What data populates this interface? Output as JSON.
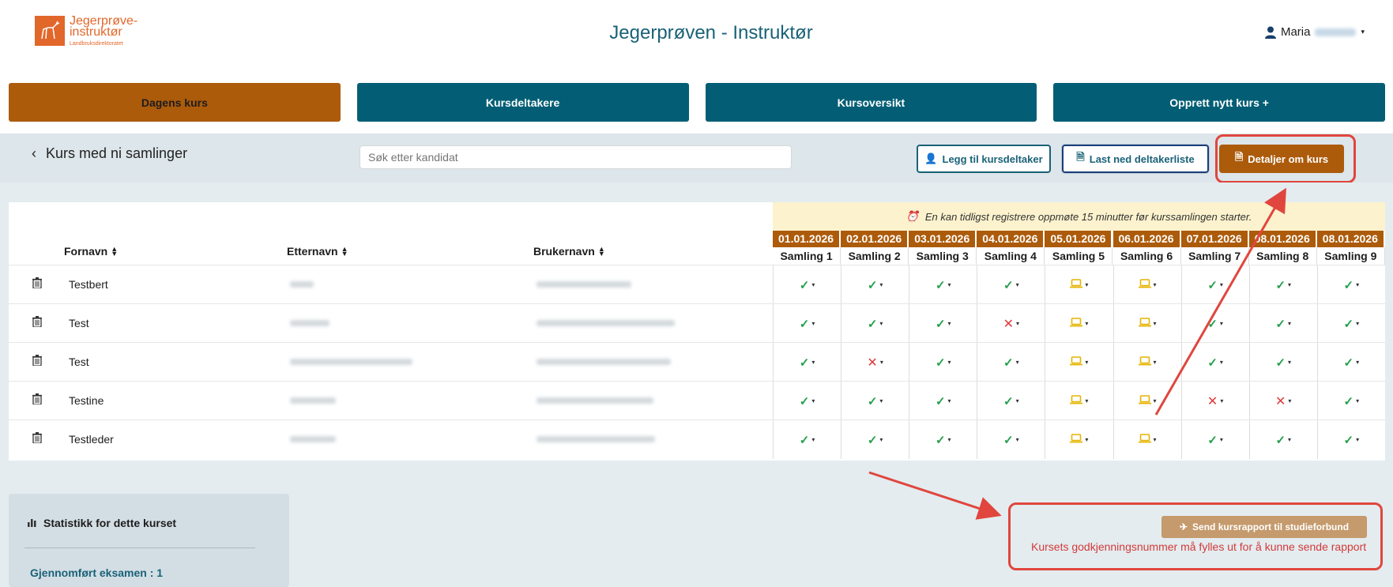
{
  "header": {
    "logo_line1": "Jegerprøve-",
    "logo_line2": "instruktør",
    "logo_sub": "Landbruksdirektoratet",
    "title": "Jegerprøven - Instruktør",
    "user_name": "Maria"
  },
  "nav": {
    "items": [
      {
        "label": "Dagens kurs",
        "active": true
      },
      {
        "label": "Kursdeltakere",
        "active": false
      },
      {
        "label": "Kursoversikt",
        "active": false
      },
      {
        "label": "Opprett nytt kurs +",
        "active": false
      }
    ]
  },
  "toolbar": {
    "back_label": "Kurs med ni samlinger",
    "search_placeholder": "Søk etter kandidat",
    "add_participant": "Legg til kursdeltaker",
    "download_list": "Last ned deltakerliste",
    "course_details": "Detaljer om kurs"
  },
  "table": {
    "notice": "En kan tidligst registrere oppmøte 15 minutter før kurssamlingen starter.",
    "columns": {
      "first": "Fornavn",
      "last": "Etternavn",
      "user": "Brukernavn"
    },
    "sessions": [
      {
        "date": "01.01.2026",
        "label": "Samling 1"
      },
      {
        "date": "02.01.2026",
        "label": "Samling 2"
      },
      {
        "date": "03.01.2026",
        "label": "Samling 3"
      },
      {
        "date": "04.01.2026",
        "label": "Samling 4"
      },
      {
        "date": "05.01.2026",
        "label": "Samling 5"
      },
      {
        "date": "06.01.2026",
        "label": "Samling 6"
      },
      {
        "date": "07.01.2026",
        "label": "Samling 7"
      },
      {
        "date": "08.01.2026",
        "label": "Samling 8"
      },
      {
        "date": "08.01.2026",
        "label": "Samling 9"
      }
    ],
    "rows": [
      {
        "first": "Testbert",
        "attendance": [
          "ok",
          "ok",
          "ok",
          "ok",
          "laptop",
          "laptop",
          "ok",
          "ok",
          "ok"
        ]
      },
      {
        "first": "Test",
        "attendance": [
          "ok",
          "ok",
          "ok",
          "no",
          "laptop",
          "laptop",
          "ok",
          "ok",
          "ok"
        ]
      },
      {
        "first": "Test",
        "attendance": [
          "ok",
          "no",
          "ok",
          "ok",
          "laptop",
          "laptop",
          "ok",
          "ok",
          "ok"
        ]
      },
      {
        "first": "Testine",
        "attendance": [
          "ok",
          "ok",
          "ok",
          "ok",
          "laptop",
          "laptop",
          "no",
          "no",
          "ok"
        ]
      },
      {
        "first": "Testleder",
        "attendance": [
          "ok",
          "ok",
          "ok",
          "ok",
          "laptop",
          "laptop",
          "ok",
          "ok",
          "ok"
        ]
      }
    ]
  },
  "stats": {
    "title": "Statistikk for dette kurset",
    "completed": "Gjennomført eksamen : 1"
  },
  "report": {
    "send_label": "Send kursrapport til studieforbund",
    "error": "Kursets godkjenningsnummer må fylles ut for å kunne sende rapport"
  },
  "colors": {
    "primary": "#035e75",
    "accent": "#ac5b0b",
    "ok": "#23a04b",
    "error": "#e03a3a",
    "laptop": "#e6b400",
    "highlight": "#e0463e"
  }
}
